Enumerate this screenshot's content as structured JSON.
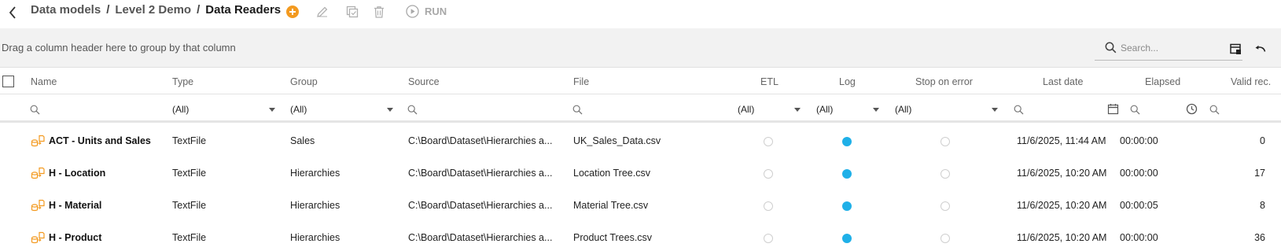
{
  "breadcrumb": [
    "Data models",
    "Level 2 Demo",
    "Data Readers"
  ],
  "breadcrumb_separator": "/",
  "toolbar": {
    "run_label": "RUN",
    "accent_color": "#f39a20",
    "disabled_color": "#b0b0b0"
  },
  "group_hint": "Drag a column header here to group by that column",
  "search": {
    "placeholder": "Search..."
  },
  "columns": {
    "name": "Name",
    "type": "Type",
    "group": "Group",
    "source": "Source",
    "file": "File",
    "etl": "ETL",
    "log": "Log",
    "stop_on_error": "Stop on error",
    "last_date": "Last date",
    "elapsed": "Elapsed",
    "valid_rec": "Valid rec."
  },
  "filters": {
    "type": "(All)",
    "group": "(All)",
    "etl": "(All)",
    "log": "(All)",
    "stop_on_error": "(All)"
  },
  "status_color_on": "#1fb0e8",
  "rows": [
    {
      "name": "ACT - Units and Sales",
      "type": "TextFile",
      "group": "Sales",
      "source": "C:\\Board\\Dataset\\Hierarchies a...",
      "file": "UK_Sales_Data.csv",
      "etl": false,
      "log": true,
      "stop_on_error": false,
      "last_date": "11/6/2025, 11:44 AM",
      "elapsed": "00:00:00",
      "valid_rec": "0"
    },
    {
      "name": "H - Location",
      "type": "TextFile",
      "group": "Hierarchies",
      "source": "C:\\Board\\Dataset\\Hierarchies a...",
      "file": "Location Tree.csv",
      "etl": false,
      "log": true,
      "stop_on_error": false,
      "last_date": "11/6/2025, 10:20 AM",
      "elapsed": "00:00:00",
      "valid_rec": "17"
    },
    {
      "name": "H - Material",
      "type": "TextFile",
      "group": "Hierarchies",
      "source": "C:\\Board\\Dataset\\Hierarchies a...",
      "file": "Material Tree.csv",
      "etl": false,
      "log": true,
      "stop_on_error": false,
      "last_date": "11/6/2025, 10:20 AM",
      "elapsed": "00:00:05",
      "valid_rec": "8"
    },
    {
      "name": "H - Product",
      "type": "TextFile",
      "group": "Hierarchies",
      "source": "C:\\Board\\Dataset\\Hierarchies a...",
      "file": "Product Trees.csv",
      "etl": false,
      "log": true,
      "stop_on_error": false,
      "last_date": "11/6/2025, 10:20 AM",
      "elapsed": "00:00:00",
      "valid_rec": "36"
    }
  ]
}
